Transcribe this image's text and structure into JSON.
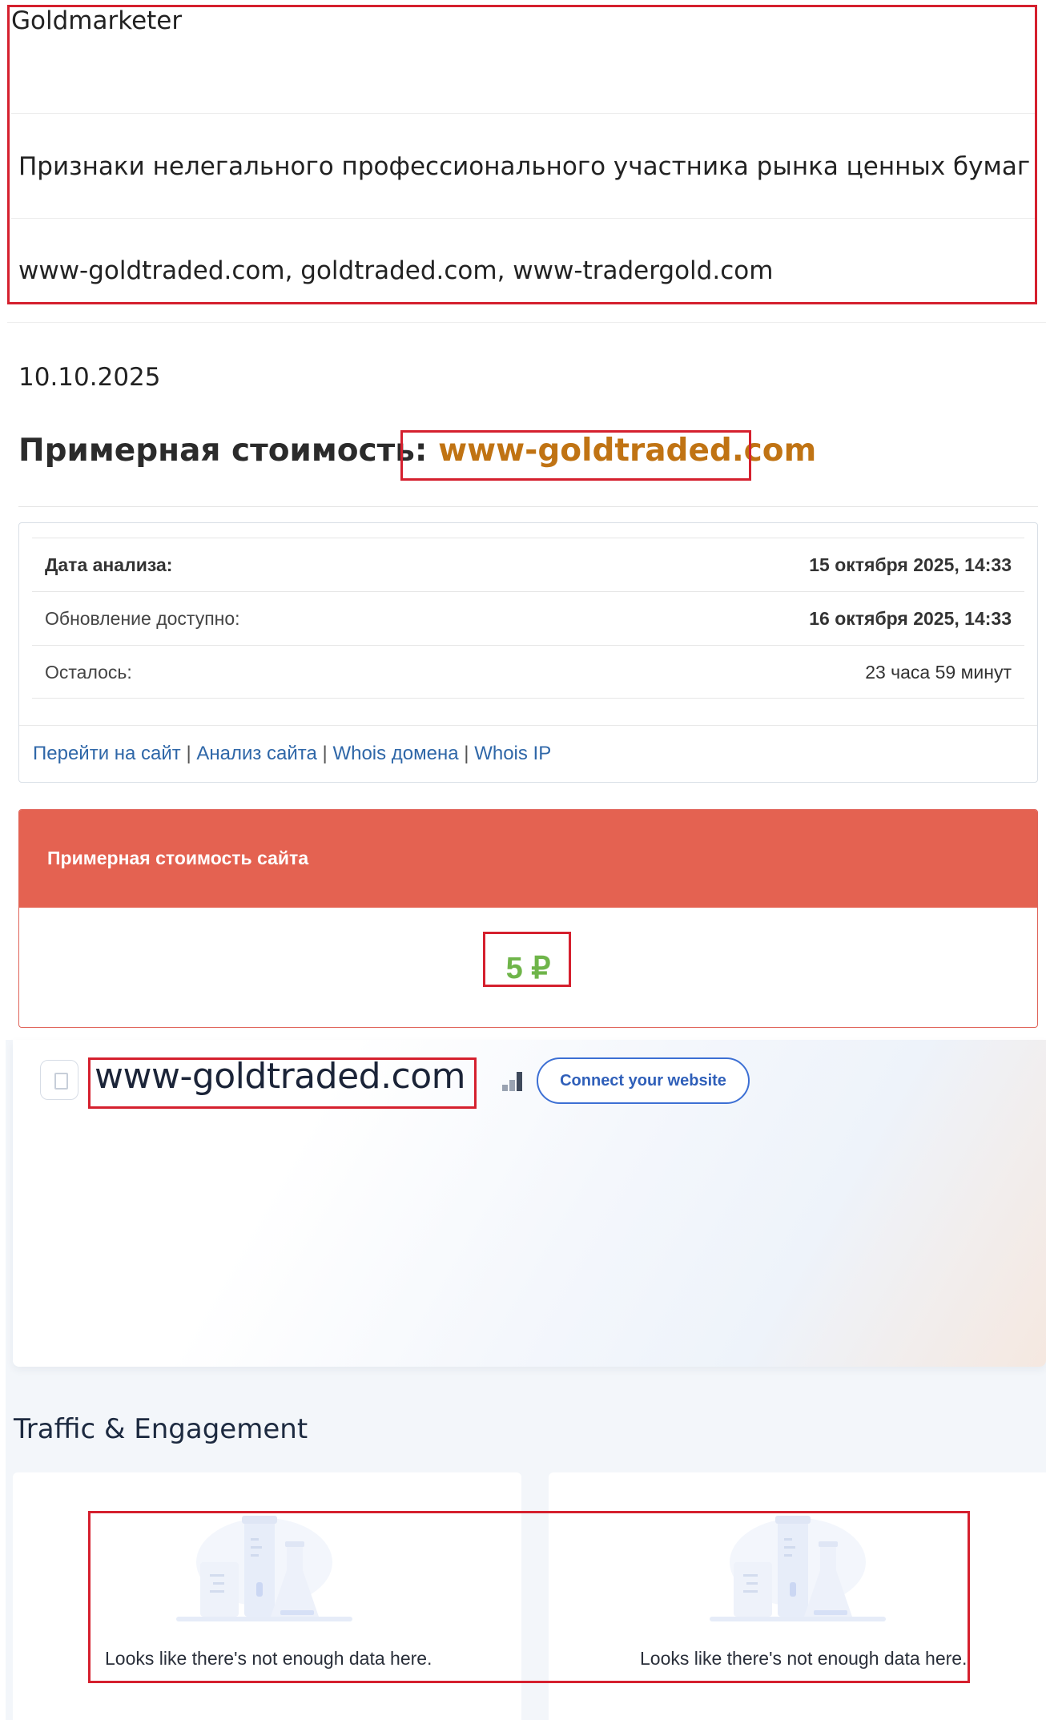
{
  "top_info": {
    "company": "Goldmarketer",
    "category": "Признаки нелегального профессионального участника рынка ценных бумаг",
    "domains": "www-goldtraded.com, goldtraded.com, www-tradergold.com"
  },
  "page_date": "10.10.2025",
  "heading": {
    "prefix": "Примерная стоимость:",
    "domain": "www-goldtraded.com"
  },
  "analysis_table": {
    "rows": [
      {
        "label": "Дата анализа:",
        "value": "15 октября 2025, 14:33"
      },
      {
        "label": "Обновление доступно:",
        "value": "16 октября 2025, 14:33"
      },
      {
        "label": "Осталось:",
        "value": "23 часа 59 минут"
      }
    ],
    "links": [
      "Перейти на сайт",
      "Анализ сайта",
      "Whois домена",
      "Whois IP"
    ],
    "separator": "|"
  },
  "cost": {
    "title": "Примерная стоимость сайта",
    "value": "5 ₽"
  },
  "similarweb": {
    "domain": "www-goldtraded.com",
    "connect_label": "Connect your website",
    "section_title": "Traffic & Engagement",
    "empty_left": "Looks like there's not enough data here.",
    "empty_right": "Looks like there's not enough data here."
  },
  "colors": {
    "highlight_border": "#d5202e",
    "cost_header": "#e46251",
    "cost_value": "#6fb54a",
    "heading_domain": "#c07313",
    "link": "#2f67a8",
    "connect_button": "#3c6fd4"
  }
}
